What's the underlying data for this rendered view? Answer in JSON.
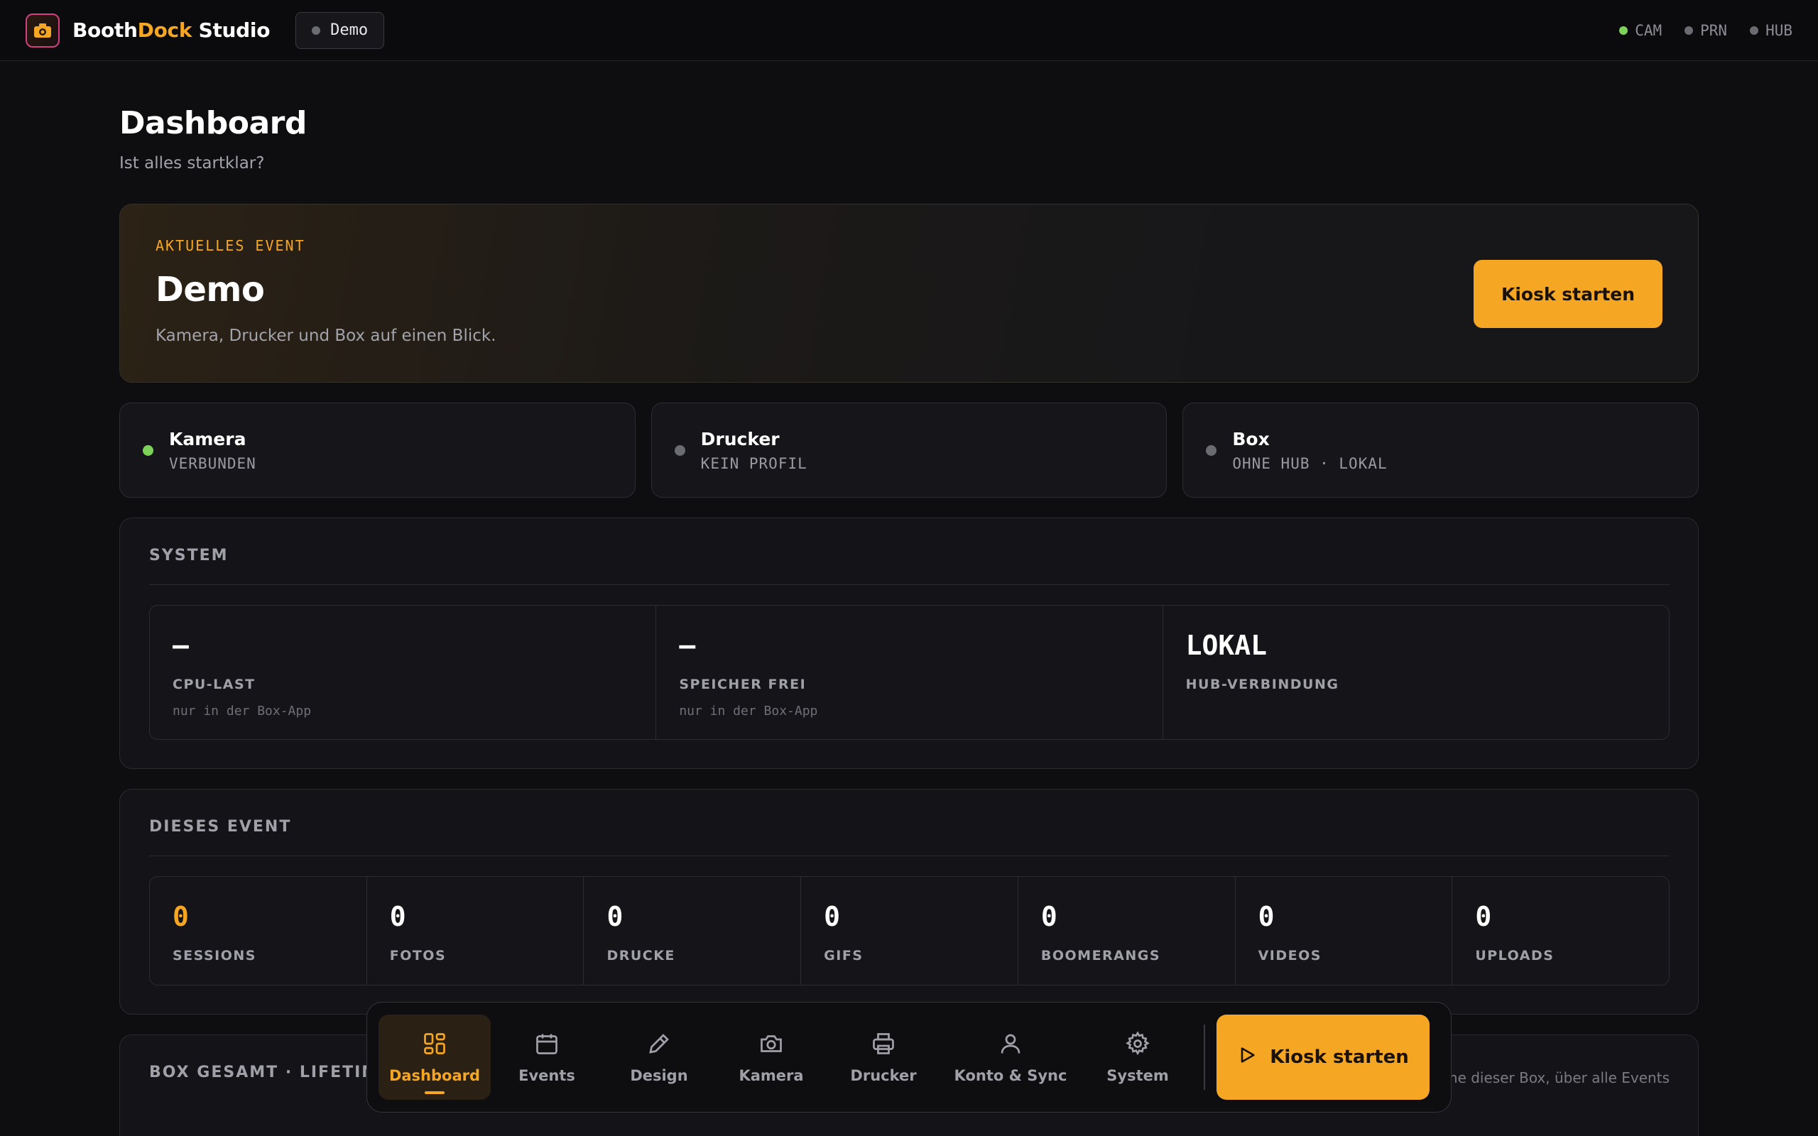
{
  "app": {
    "brand_part1": "Booth",
    "brand_part2": "Dock",
    "brand_part3": " Studio",
    "event_chip": "Demo",
    "status": [
      {
        "label": "CAM",
        "state": "connected"
      },
      {
        "label": "PRN",
        "state": "off"
      },
      {
        "label": "HUB",
        "state": "off"
      }
    ]
  },
  "page": {
    "title": "Dashboard",
    "subtitle": "Ist alles startklar?"
  },
  "hero": {
    "eyebrow": "AKTUELLES EVENT",
    "title": "Demo",
    "subtitle": "Kamera, Drucker und Box auf einen Blick.",
    "button": "Kiosk starten"
  },
  "devices": [
    {
      "name": "Kamera",
      "state": "VERBUNDEN",
      "ok": true
    },
    {
      "name": "Drucker",
      "state": "KEIN PROFIL",
      "ok": false
    },
    {
      "name": "Box",
      "state": "OHNE HUB · LOKAL",
      "ok": false
    }
  ],
  "system": {
    "heading": "SYSTEM",
    "metrics": [
      {
        "value": "–",
        "label": "CPU-LAST",
        "note": "nur in der Box-App"
      },
      {
        "value": "–",
        "label": "SPEICHER FREI",
        "note": "nur in der Box-App"
      },
      {
        "value": "LOKAL",
        "label": "HUB-VERBINDUNG",
        "note": ""
      }
    ]
  },
  "event_stats": {
    "heading": "DIESES EVENT",
    "metrics": [
      {
        "value": "0",
        "label": "SESSIONS"
      },
      {
        "value": "0",
        "label": "FOTOS"
      },
      {
        "value": "0",
        "label": "DRUCKE"
      },
      {
        "value": "0",
        "label": "GIFS"
      },
      {
        "value": "0",
        "label": "BOOMERANGS"
      },
      {
        "value": "0",
        "label": "VIDEOS"
      },
      {
        "value": "0",
        "label": "UPLOADS"
      }
    ]
  },
  "lifetime": {
    "heading": "BOX GESAMT · LIFETIME",
    "note": "ime dieser Box, über alle Events"
  },
  "nav": {
    "items": [
      {
        "label": "Dashboard",
        "icon": "grid-icon"
      },
      {
        "label": "Events",
        "icon": "calendar-icon"
      },
      {
        "label": "Design",
        "icon": "pencil-icon"
      },
      {
        "label": "Kamera",
        "icon": "camera-icon"
      },
      {
        "label": "Drucker",
        "icon": "printer-icon"
      },
      {
        "label": "Konto & Sync",
        "icon": "user-icon"
      },
      {
        "label": "System",
        "icon": "gear-icon"
      }
    ],
    "cta": "Kiosk starten",
    "cta_icon": "play-icon"
  },
  "colors": {
    "accent": "#f5a623",
    "background": "#0e0e11",
    "ok": "#7dd35a",
    "inactive": "#6b6b72"
  }
}
